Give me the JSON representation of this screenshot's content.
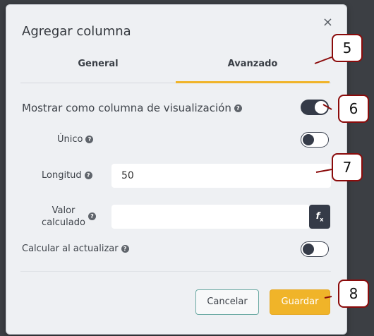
{
  "dialog": {
    "title": "Agregar columna",
    "close_icon": "×"
  },
  "tabs": [
    {
      "label": "General",
      "active": false
    },
    {
      "label": "Avanzado",
      "active": true
    }
  ],
  "fields": {
    "display_column": {
      "label": "Mostrar como columna de visualización",
      "checked": true
    },
    "unique": {
      "label": "Único",
      "checked": false
    },
    "length": {
      "label": "Longitud",
      "value": "50"
    },
    "calculated": {
      "label_line1": "Valor",
      "label_line2": "calculado",
      "value": "",
      "fx_label": "f",
      "fx_sub": "x"
    },
    "calc_on_update": {
      "label": "Calcular al actualizar",
      "checked": false
    }
  },
  "help_icon": "?",
  "buttons": {
    "cancel": "Cancelar",
    "save": "Guardar"
  },
  "callouts": [
    "5",
    "6",
    "7",
    "8"
  ],
  "colors": {
    "accent": "#f0b429",
    "toggle_dark": "#353b48",
    "callout_border": "#8b0b0b"
  }
}
